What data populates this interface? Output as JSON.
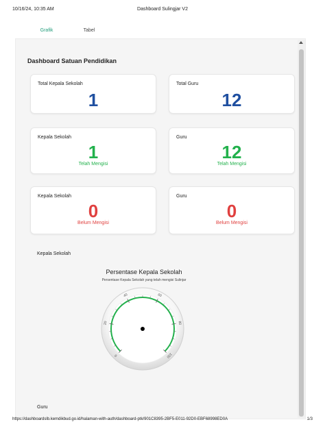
{
  "print_header": {
    "date": "10/16/24, 10:35 AM",
    "title": "Dashboard Sulingjar V2"
  },
  "tabs": [
    {
      "label": "Grafik",
      "active": true
    },
    {
      "label": "Tabel",
      "active": false
    }
  ],
  "dashboard": {
    "title": "Dashboard Satuan Pendidikan",
    "cards": {
      "total_kepala": {
        "label": "Total Kepala Sekolah",
        "value": "1"
      },
      "total_guru": {
        "label": "Total Guru",
        "value": "12"
      },
      "kepala_mengisi": {
        "label": "Kepala Sekolah",
        "value": "1",
        "status": "Telah Mengisi"
      },
      "guru_mengisi": {
        "label": "Guru",
        "value": "12",
        "status": "Telah Mengisi"
      },
      "kepala_belum": {
        "label": "Kepala Sekolah",
        "value": "0",
        "status": "Belum Mengisi"
      },
      "guru_belum": {
        "label": "Guru",
        "value": "0",
        "status": "Belum Mengisi"
      }
    },
    "section_kepala": "Kepala Sekolah",
    "section_guru": "Guru"
  },
  "gauge": {
    "title": "Persentase Kepala Sekolah",
    "subtitle": "Persentase Kepala Sekolah yang telah mengisi Sulinjar",
    "ticks": [
      "0",
      "20",
      "40",
      "60",
      "80",
      "100"
    ],
    "min": 0,
    "max": 100,
    "value": 100
  },
  "colors": {
    "accent": "#1f9c7a",
    "blue": "#1f4fa0",
    "green": "#22b14c",
    "red": "#e0403f"
  },
  "print_footer": {
    "url": "https://dashboardslb.kemdikbud.go.id/halaman-with-auth/dashboard-ptk/901C8395-2BF5-E011-92D0-EBF68998ED0A",
    "page": "1/3"
  }
}
